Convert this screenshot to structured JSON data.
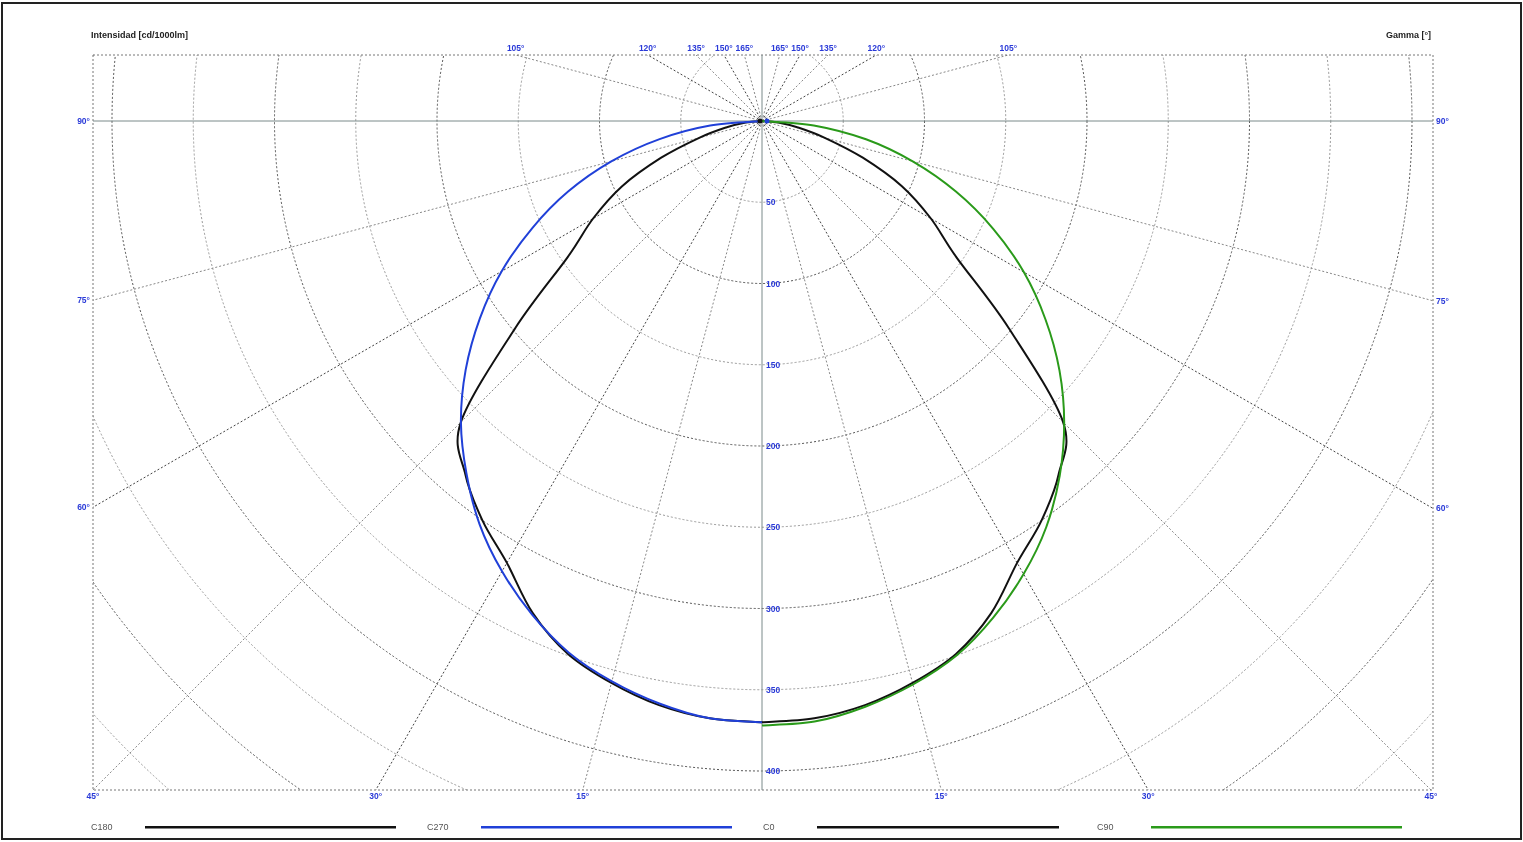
{
  "diagram": {
    "axis_title_left": "Intensidad [cd/1000lm]",
    "axis_title_right": "Gamma [°]",
    "angle_labels_top": [
      "105°",
      "120°",
      "135°",
      "150°",
      "165°",
      "165°",
      "150°",
      "135°",
      "120°",
      "105°"
    ],
    "angle_labels_left": [
      "90°",
      "75°",
      "60°"
    ],
    "angle_labels_right": [
      "90°",
      "75°",
      "60°"
    ],
    "angle_labels_bottom": [
      "45°",
      "30°",
      "15°",
      "15°",
      "30°",
      "45°"
    ],
    "radial_labels": [
      "50",
      "100",
      "150",
      "200",
      "250",
      "300",
      "350",
      "400"
    ],
    "legend": [
      {
        "name": "C180",
        "color": "#111111"
      },
      {
        "name": "C270",
        "color": "#2040d8"
      },
      {
        "name": "C0",
        "color": "#111111"
      },
      {
        "name": "C90",
        "color": "#2a9a1a"
      }
    ]
  }
}
